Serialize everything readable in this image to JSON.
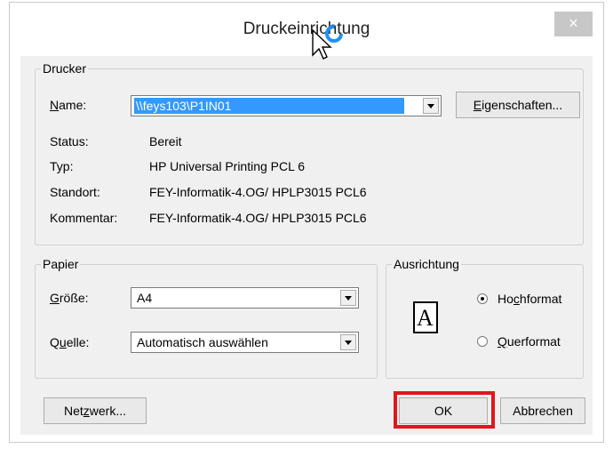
{
  "dialog": {
    "title": "Druckeinrichtung",
    "close_glyph": "×"
  },
  "printer": {
    "group_label": "Drucker",
    "name_label_prefix": "N",
    "name_label_ul": "",
    "name_label": "Name:",
    "name_value": "\\\\feys103\\P1IN01",
    "properties_button": "Eigenschaften...",
    "status_label": "Status:",
    "status_value": "Bereit",
    "type_label": "Typ:",
    "type_value": "HP Universal Printing PCL 6",
    "location_label": "Standort:",
    "location_value": "FEY-Informatik-4.OG/  HPLP3015 PCL6",
    "comment_label": "Kommentar:",
    "comment_value": "FEY-Informatik-4.OG/  HPLP3015 PCL6"
  },
  "paper": {
    "group_label": "Papier",
    "size_label": "Größe:",
    "size_value": "A4",
    "source_label": "Quelle:",
    "source_value": "Automatisch auswählen"
  },
  "orientation": {
    "group_label": "Ausrichtung",
    "portrait_label": "Hochformat",
    "portrait_selected": true,
    "landscape_label": "Querformat",
    "landscape_selected": false,
    "icon_letter": "A"
  },
  "buttons": {
    "network": "Netzwerk...",
    "ok": "OK",
    "cancel": "Abbrechen"
  },
  "colors": {
    "highlight": "#e0161d",
    "selection": "#3399ff"
  }
}
